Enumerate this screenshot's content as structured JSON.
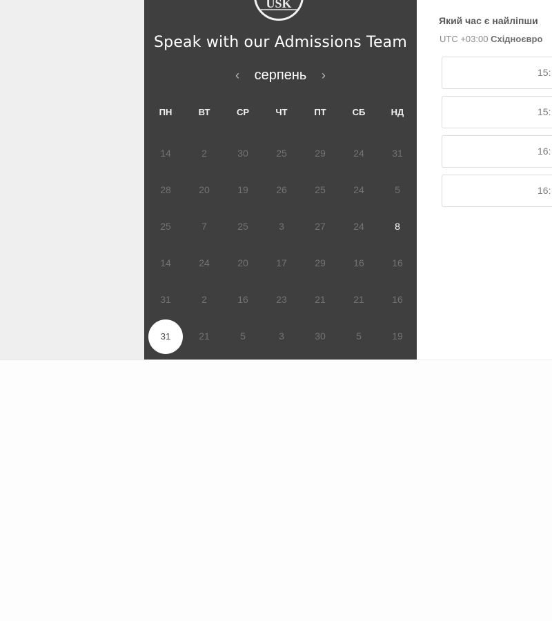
{
  "left_panel": {
    "title": "Speak with our Admissions Team",
    "logo": {
      "text": "USK"
    },
    "month": "серпень",
    "prev_icon": "‹",
    "next_icon": "›",
    "weekdays": [
      "ПН",
      "ВТ",
      "СР",
      "ЧТ",
      "ПТ",
      "СБ",
      "НД"
    ],
    "weeks": [
      [
        "14",
        "2",
        "30",
        "25",
        "29",
        "24",
        "31"
      ],
      [
        "28",
        "20",
        "19",
        "26",
        "25",
        "24",
        "5"
      ],
      [
        "25",
        "7",
        "25",
        "3",
        "27",
        "24",
        "8"
      ],
      [
        "14",
        "24",
        "20",
        "17",
        "29",
        "16",
        "16"
      ],
      [
        "31",
        "2",
        "16",
        "23",
        "21",
        "21",
        "16"
      ],
      [
        "31",
        "21",
        "5",
        "3",
        "30",
        "5",
        "19"
      ]
    ],
    "active_day": {
      "week": 2,
      "col": 6
    },
    "selected_day": {
      "week": 5,
      "col": 0
    }
  },
  "right_panel": {
    "question": "Який час є найліпши",
    "timezone_offset": "UTC +03:00",
    "timezone_name": "Східноєвро",
    "slots": [
      "15:",
      "15:",
      "16:",
      "16:"
    ]
  },
  "colors": {
    "panel_bg": "#3f3f3f",
    "muted_day": "#737373",
    "active_day": "#ffffff"
  }
}
